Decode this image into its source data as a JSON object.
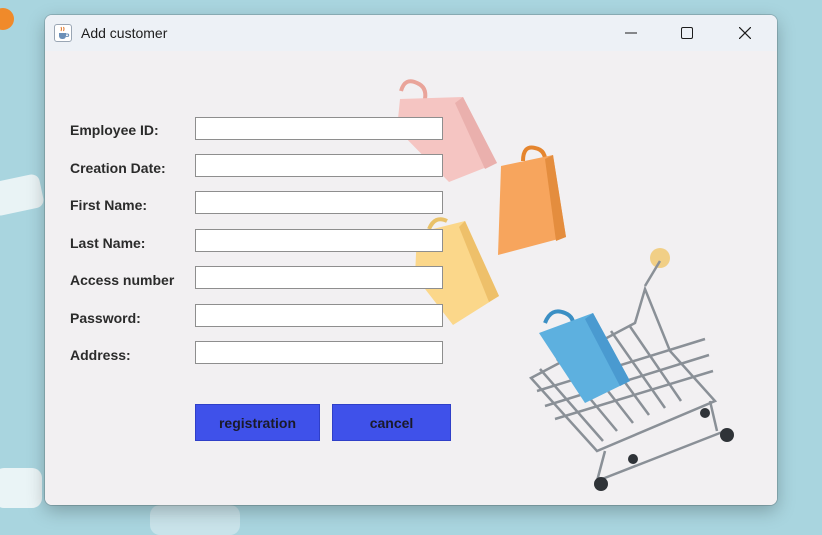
{
  "window": {
    "title": "Add customer",
    "icon": "java-cup-icon",
    "controls": [
      "minimize-icon",
      "maximize-icon",
      "close-icon"
    ]
  },
  "form": {
    "fields": [
      {
        "label": "Employee ID:",
        "value": "",
        "placeholder": ""
      },
      {
        "label": "Creation Date:",
        "value": "",
        "placeholder": ""
      },
      {
        "label": "First Name:",
        "value": "",
        "placeholder": ""
      },
      {
        "label": "Last Name:",
        "value": "",
        "placeholder": ""
      },
      {
        "label": "Access number",
        "value": "",
        "placeholder": ""
      },
      {
        "label": "Password:",
        "value": "",
        "placeholder": ""
      },
      {
        "label": "Address:",
        "value": "",
        "placeholder": ""
      }
    ],
    "buttons": {
      "registration": "registration",
      "cancel": "cancel"
    }
  },
  "colors": {
    "button": "#3f51ea",
    "window_bg": "#f2f0f2",
    "titlebar_bg": "#edf1f6",
    "desktop_bg": "#a9d5df"
  }
}
